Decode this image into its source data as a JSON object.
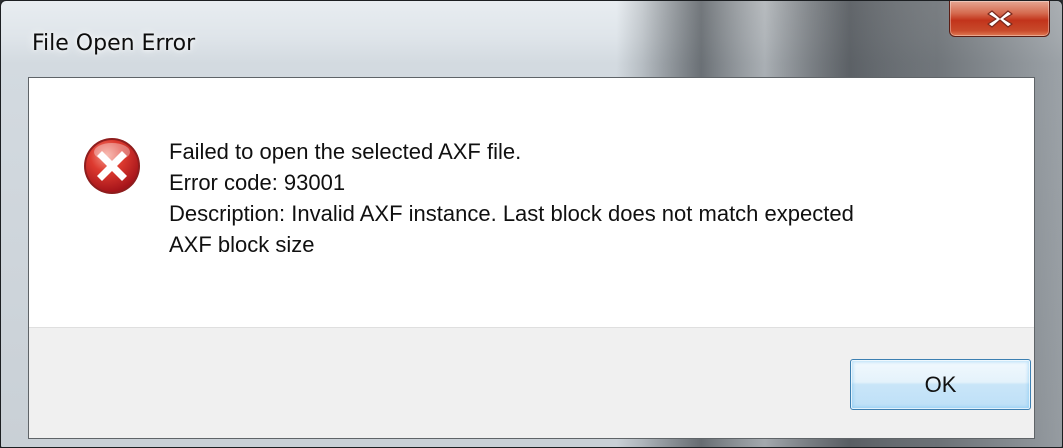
{
  "window": {
    "title": "File Open Error"
  },
  "icons": {
    "close": "close-icon",
    "error": "error-icon"
  },
  "message": {
    "line1": "Failed to open the selected AXF file.",
    "line2": "Error code: 93001",
    "line3": "Description: Invalid AXF instance.  Last block does not match expected",
    "line4": "AXF block size"
  },
  "buttons": {
    "ok_label": "OK"
  },
  "colors": {
    "error_red": "#d0282a",
    "close_button_red": "#c2341b",
    "ok_button_border": "#3c7fb1"
  }
}
